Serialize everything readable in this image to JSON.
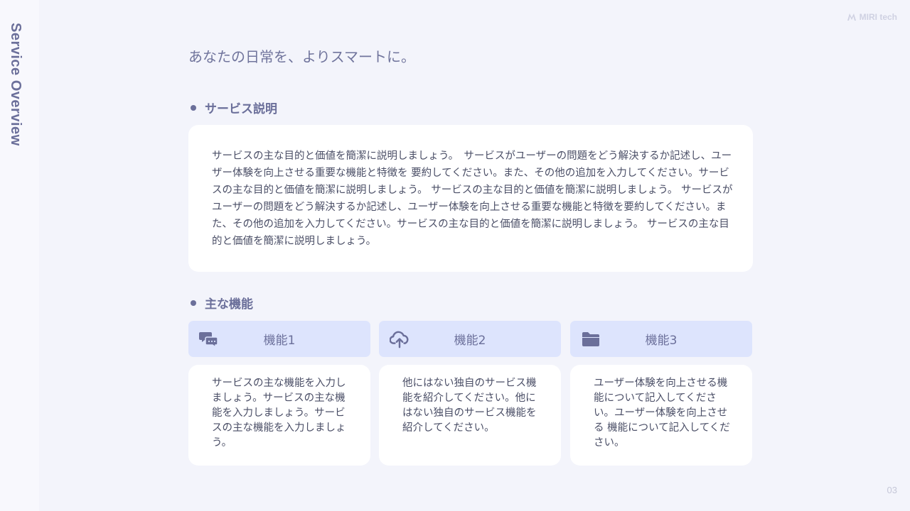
{
  "side_label": "Service Overview",
  "logo_text": "MIRI tech",
  "page_number": "03",
  "headline": "あなたの日常を、よりスマートに。",
  "section_description": {
    "title": "サービス説明",
    "body": "サービスの主な目的と価値を簡潔に説明しましょう。　サービスがユーザーの問題をどう解決するか記述し、ユーザー体験を向上させる重要な機能と特徴を 要約してください。また、その他の追加を入力してください。サービスの主な目的と価値を簡潔に説明しましょう。 サービスの主な目的と価値を簡潔に説明しましょう。 サービスがユーザーの問題をどう解決するか記述し、ユーザー体験を向上させる重要な機能と特徴を要約してください。また、その他の追加を入力してください。サービスの主な目的と価値を簡潔に説明しましょう。 サービスの主な目的と価値を簡潔に説明しましょう。"
  },
  "section_features": {
    "title": "主な機能",
    "items": [
      {
        "title": "機能1",
        "icon": "chat-bubbles-icon",
        "body": "サービスの主な機能を入力しましょう。サービスの主な機能を入力しましょう。サービスの主な機能を入力しましょう。"
      },
      {
        "title": "機能2",
        "icon": "cloud-upload-icon",
        "body": "他にはない独自のサービス機能を紹介してください。他にはない独自のサービス機能を紹介してください。"
      },
      {
        "title": "機能3",
        "icon": "folder-icon",
        "body": "ユーザー体験を向上させる機能について記入してください。ユーザー体験を向上させる 機能について記入してください。"
      }
    ]
  },
  "colors": {
    "accent": "#6b6f9a",
    "feature_header_bg": "#dde4fd",
    "page_bg": "#f3f4fb",
    "card_bg": "#ffffff"
  }
}
